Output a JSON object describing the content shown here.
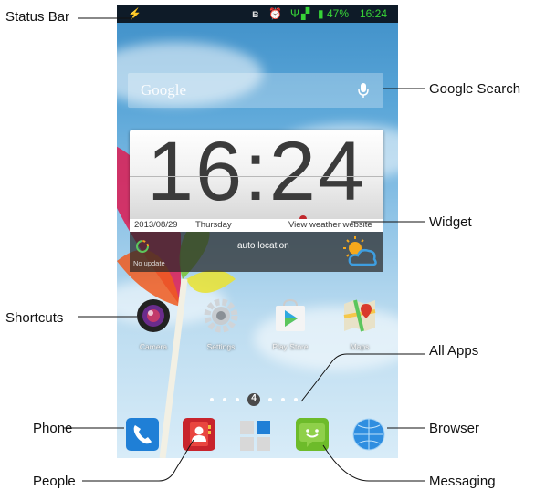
{
  "callouts": {
    "status_bar": "Status Bar",
    "google_search": "Google Search",
    "widget": "Widget",
    "shortcuts": "Shortcuts",
    "all_apps": "All Apps",
    "phone": "Phone",
    "browser": "Browser",
    "people": "People",
    "messaging": "Messaging"
  },
  "status_bar": {
    "battery": "47%",
    "time": "16:24",
    "icons": [
      "usb-icon",
      "bluetooth-icon",
      "alarm-icon",
      "wifi-icon",
      "signal-icon",
      "battery-icon"
    ]
  },
  "search": {
    "brand": "Google"
  },
  "clock_widget": {
    "time": "16:24",
    "date": "2013/08/29",
    "day": "Thursday",
    "link": "View weather website",
    "location": "auto location",
    "update": "No update"
  },
  "shortcuts": [
    {
      "label": "Camera",
      "icon": "camera-icon"
    },
    {
      "label": "Settings",
      "icon": "settings-icon"
    },
    {
      "label": "Play Store",
      "icon": "play-store-icon"
    },
    {
      "label": "Maps",
      "icon": "maps-icon"
    }
  ],
  "page_indicator": {
    "current": "4"
  },
  "dock": [
    {
      "name": "Phone",
      "icon": "phone-icon"
    },
    {
      "name": "People",
      "icon": "people-icon"
    },
    {
      "name": "All Apps",
      "icon": "all-apps-icon"
    },
    {
      "name": "Messaging",
      "icon": "messaging-icon"
    },
    {
      "name": "Browser",
      "icon": "browser-icon"
    }
  ],
  "colors": {
    "status_green": "#37d337",
    "status_bar_bg": "#0e1b28",
    "sky_top": "#3f8fc8",
    "sky_bottom": "#d8ecf8"
  }
}
